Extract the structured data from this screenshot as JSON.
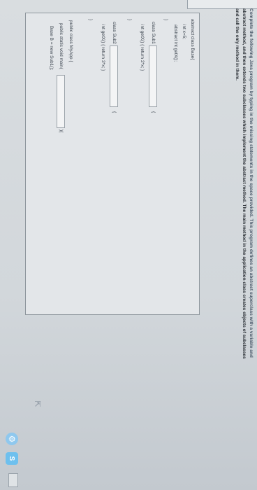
{
  "question": {
    "lead": "Complete the following Java program by typing in the missing statements in the space provided. This program defines an abstract superclass with a variable and",
    "line2": "abstract method, and then extends two subclasses which implement the abstract method. The main method in the application class creates objects of subclasses",
    "line3": "and call the only method in them."
  },
  "code": {
    "l1": "abstract class Base{",
    "l2": "int x=5;",
    "l3": "abstract int getX();",
    "l4": "}",
    "l5": "class Sub1",
    "l5_brace": "{",
    "l6": "int getX() { return  2*x; }",
    "l7": "}",
    "l8": "class Sub2",
    "l8_brace": "{",
    "l9": "int getX() { return  3*x; }",
    "l10": "}",
    "l11": "public class MyApp {",
    "l12": "public static void main(",
    "l12_tail": "){",
    "l13": "Base B = new Sub1();"
  },
  "icons": {
    "gear": "settings-gear-icon",
    "launcher": "app-launcher-icon",
    "cursor": "mouse-cursor-icon"
  },
  "colors": {
    "accent": "#6ec0ee",
    "background": "#d2d7db"
  }
}
